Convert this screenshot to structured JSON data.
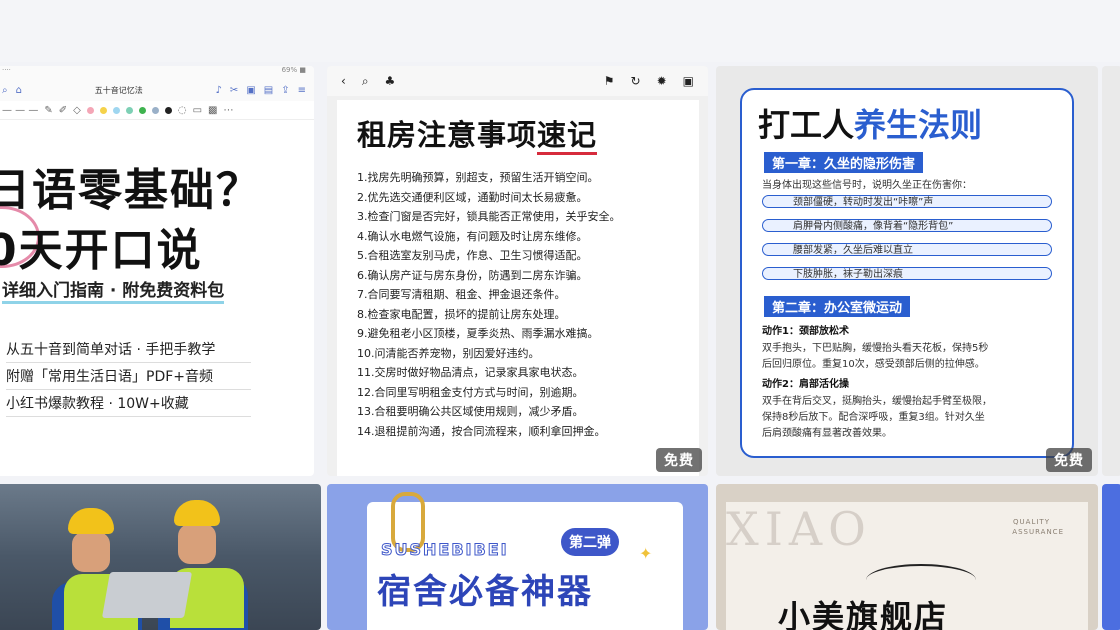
{
  "colors": {
    "accent_blue": "#2a5ecf",
    "red_underline": "#d62b3c",
    "helmet_yellow": "#f2c21a"
  },
  "free_badge": "免费",
  "card1": {
    "status_left": "····",
    "status_right": "69% ■",
    "app_title": "五十音记忆法",
    "line1": "日语零基础？",
    "line2": "0天开口说",
    "subtitle": "详细入门指南 · 附免费资料包",
    "bullets": [
      "从五十音到简单对话 · 手把手教学",
      "附赠「常用生活日语」PDF+音频",
      "小红书爆款教程 · 10W+收藏"
    ]
  },
  "card2": {
    "title_main": "租房注意事项",
    "title_underlined": "速记",
    "items": [
      "1.找房先明确预算，别超支，预留生活开销空间。",
      "2.优先选交通便利区域，通勤时间太长易疲惫。",
      "3.检查门窗是否完好，锁具能否正常使用，关乎安全。",
      "4.确认水电燃气设施，有问题及时让房东维修。",
      "5.合租选室友别马虎，作息、卫生习惯得适配。",
      "6.确认房产证与房东身份，防遇到二房东诈骗。",
      "7.合同要写清租期、租金、押金退还条件。",
      "8.检查家电配置，损坏的提前让房东处理。",
      "9.避免租老小区顶楼，夏季炎热、雨季漏水难搞。",
      "10.问清能否养宠物，别因爱好违约。",
      "11.交房时做好物品清点，记录家具家电状态。",
      "12.合同里写明租金支付方式与时间，别逾期。",
      "13.合租要明确公共区域使用规则，减少矛盾。",
      "14.退租提前沟通，按合同流程来，顺利拿回押金。"
    ]
  },
  "card3": {
    "title_black": "打工人",
    "title_blue": "养生法则",
    "chapter1": "第一章：久坐的隐形伤害",
    "intro": "当身体出现这些信号时，说明久坐正在伤害你：",
    "signals": [
      "颈部僵硬，转动时发出“咔嚓”声",
      "肩胛骨内侧酸痛，像背着“隐形背包”",
      "腰部发紧，久坐后难以直立",
      "下肢肿胀，袜子勒出深痕"
    ],
    "chapter2": "第二章：办公室微运动",
    "action1_title": "动作1：颈部放松术",
    "action1_l1": "双手抱头，下巴贴胸，缓慢抬头看天花板，保持5秒",
    "action1_l2": "后回归原位。重复10次，感受颈部后侧的拉伸感。",
    "action2_title": "动作2：肩部活化操",
    "action2_l1": "双手在背后交叉，挺胸抬头，缓慢抬起手臂至极限，",
    "action2_l2": "保持8秒后放下。配合深呼吸，重复3组。针对久坐",
    "action2_l3": "后肩颈酸痛有显著改善效果。"
  },
  "card5": {
    "latin": "SUSHEBIBEI",
    "tag": "第二弹",
    "title": "宿舍必备神器"
  },
  "card6": {
    "watermark": "XIAO",
    "quality1": "QUALITY",
    "quality2": "ASSURANCE",
    "shop": "小美旗舰店"
  }
}
